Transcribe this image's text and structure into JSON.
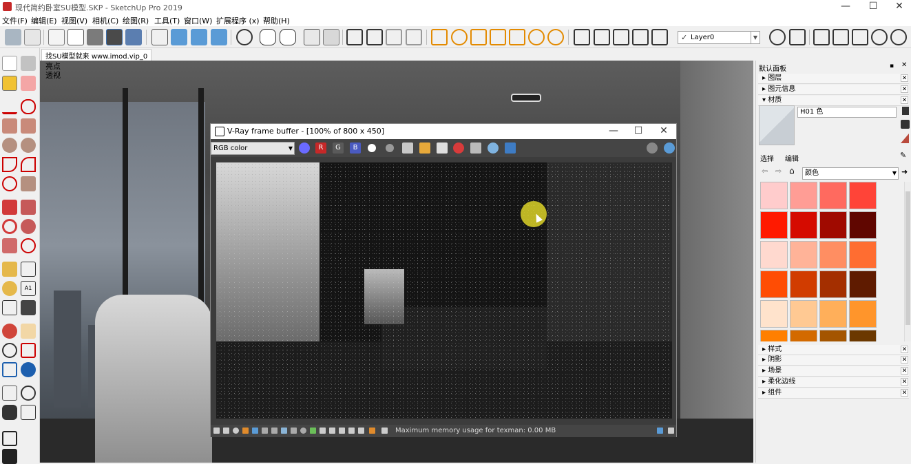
{
  "window": {
    "title": "现代简约卧室SU模型.SKP - SketchUp Pro 2019",
    "minimize": "—",
    "maximize": "☐",
    "close": "✕"
  },
  "menu": [
    "文件(F)",
    "编辑(E)",
    "视图(V)",
    "相机(C)",
    "绘图(R)",
    "工具(T)",
    "窗口(W)",
    "扩展程序 (x)",
    "帮助(H)"
  ],
  "toolbar": {
    "layer_value": "Layer0",
    "layer_check": "✓"
  },
  "document_tab": "找SU模型就来 www.imod.vip_0",
  "viewport": {
    "label_line1": "亮点",
    "label_line2": "透视"
  },
  "vray": {
    "title": "V-Ray frame buffer - [100% of 800 x 450]",
    "channel": "RGB color",
    "btn_r": "R",
    "btn_g": "G",
    "btn_b": "B",
    "status": "Maximum memory usage for texman: 0.00 MB",
    "minimize": "—",
    "maximize": "☐",
    "close": "✕"
  },
  "panel": {
    "title": "默认面板",
    "sections_top": [
      "图层",
      "图元信息"
    ],
    "materials_label": "材质",
    "material_name": "H01 色",
    "tab_select": "选择",
    "tab_edit": "编辑",
    "color_category": "颜色",
    "sections_bottom": [
      "样式",
      "阴影",
      "场景",
      "柔化边线",
      "组件"
    ],
    "swatches": [
      [
        "#FFCCCC",
        "#FF9D95",
        "#FF6A5F",
        "#FF4438"
      ],
      [
        "#FF1A00",
        "#D50B00",
        "#A00A00",
        "#600600"
      ],
      [
        "#FFD9CF",
        "#FFB398",
        "#FF8E62",
        "#FF6D31"
      ],
      [
        "#FF4D04",
        "#D13C00",
        "#A42F00",
        "#5F1B00"
      ],
      [
        "#FFE3CC",
        "#FFC993",
        "#FFAF5A",
        "#FF952B"
      ],
      [
        "#FF7F00",
        "#D36A00",
        "#A45500",
        "#6B3800"
      ]
    ]
  }
}
